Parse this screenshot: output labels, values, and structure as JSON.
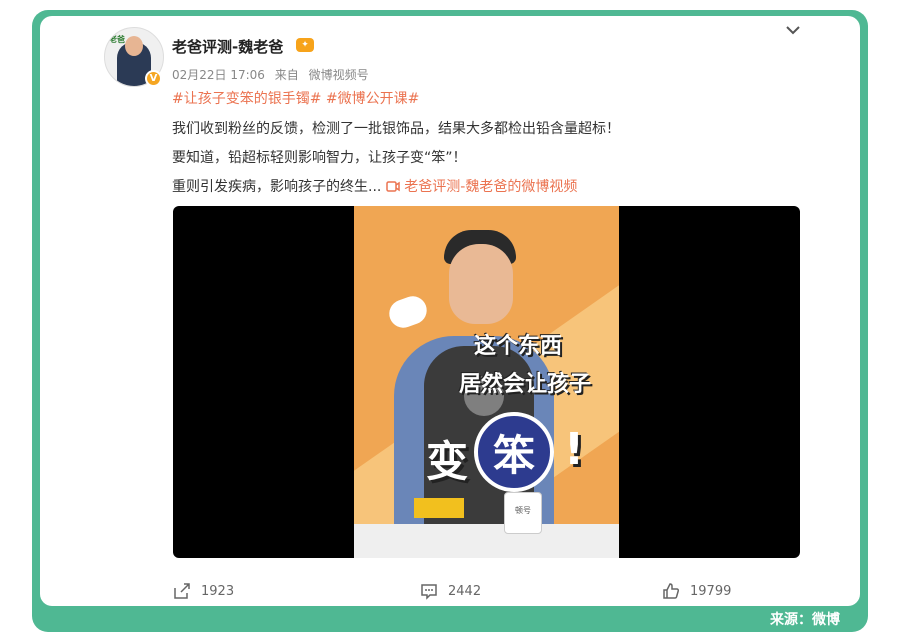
{
  "post": {
    "username": "老爸评测-魏老爸",
    "date": "02月22日 17:06",
    "source_prefix": "来自",
    "source": "微博视频号",
    "hashtags": "#让孩子变笨的银手镯# #微博公开课#",
    "line1": "我们收到粉丝的反馈，检测了一批银饰品，结果大多都检出铅含量超标！",
    "line2": "要知道，铅超标轻则影响智力，让孩子变“笨”！",
    "line3": "重则引发疾病，影响孩子的终生...",
    "video_link": "老爸评测-魏老爸的微博视频"
  },
  "video": {
    "caption1": "这个东西",
    "caption2": "居然会让孩子",
    "caption3a": "变",
    "caption3b": "笨",
    "caption3c": "!",
    "mug_text": "顿号"
  },
  "actions": {
    "share_count": "1923",
    "comment_count": "2442",
    "like_count": "19799"
  },
  "footer": {
    "source": "来源：微博"
  },
  "colors": {
    "frame": "#4fb893",
    "link": "#eb7350"
  }
}
